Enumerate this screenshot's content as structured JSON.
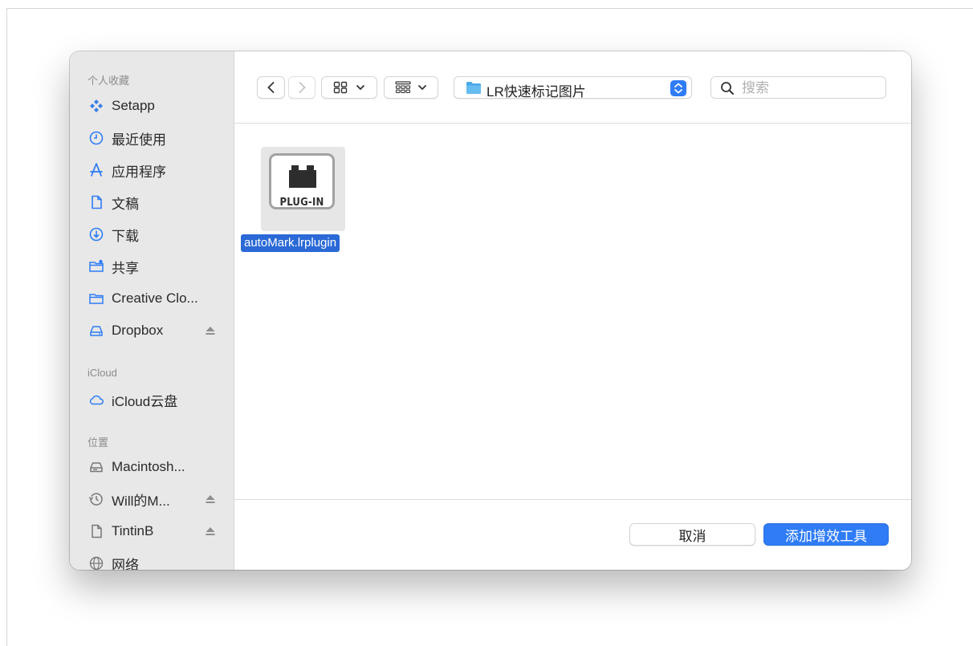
{
  "sidebar": {
    "sections": [
      {
        "title": "个人收藏",
        "items": [
          {
            "label": "Setapp",
            "icon": "setapp-icon"
          },
          {
            "label": "最近使用",
            "icon": "clock-icon"
          },
          {
            "label": "应用程序",
            "icon": "applications-icon"
          },
          {
            "label": "文稿",
            "icon": "document-icon"
          },
          {
            "label": "下载",
            "icon": "download-icon"
          },
          {
            "label": "共享",
            "icon": "shared-folder-icon"
          },
          {
            "label": "Creative Clo...",
            "icon": "folder-icon"
          },
          {
            "label": "Dropbox",
            "icon": "drive-icon",
            "ejectable": true
          }
        ]
      },
      {
        "title": "iCloud",
        "items": [
          {
            "label": "iCloud云盘",
            "icon": "cloud-icon"
          }
        ]
      },
      {
        "title": "位置",
        "items": [
          {
            "label": "Macintosh...",
            "icon": "disk-icon"
          },
          {
            "label": "Will的M...",
            "icon": "time-machine-icon",
            "ejectable": true
          },
          {
            "label": "TintinB",
            "icon": "document-icon",
            "ejectable": true
          },
          {
            "label": "网络",
            "icon": "network-icon"
          }
        ]
      }
    ]
  },
  "toolbar": {
    "current_folder": "LR快速标记图片",
    "search_placeholder": "搜索",
    "search_value": ""
  },
  "files": [
    {
      "name": "autoMark.lrplugin",
      "icon_text": "PLUG-IN",
      "selected": true
    }
  ],
  "footer": {
    "cancel_label": "取消",
    "confirm_label": "添加增效工具"
  },
  "colors": {
    "accent": "#2f7cf6",
    "selection": "#2a69d6",
    "sidebar_bg": "#e8e8e8"
  }
}
